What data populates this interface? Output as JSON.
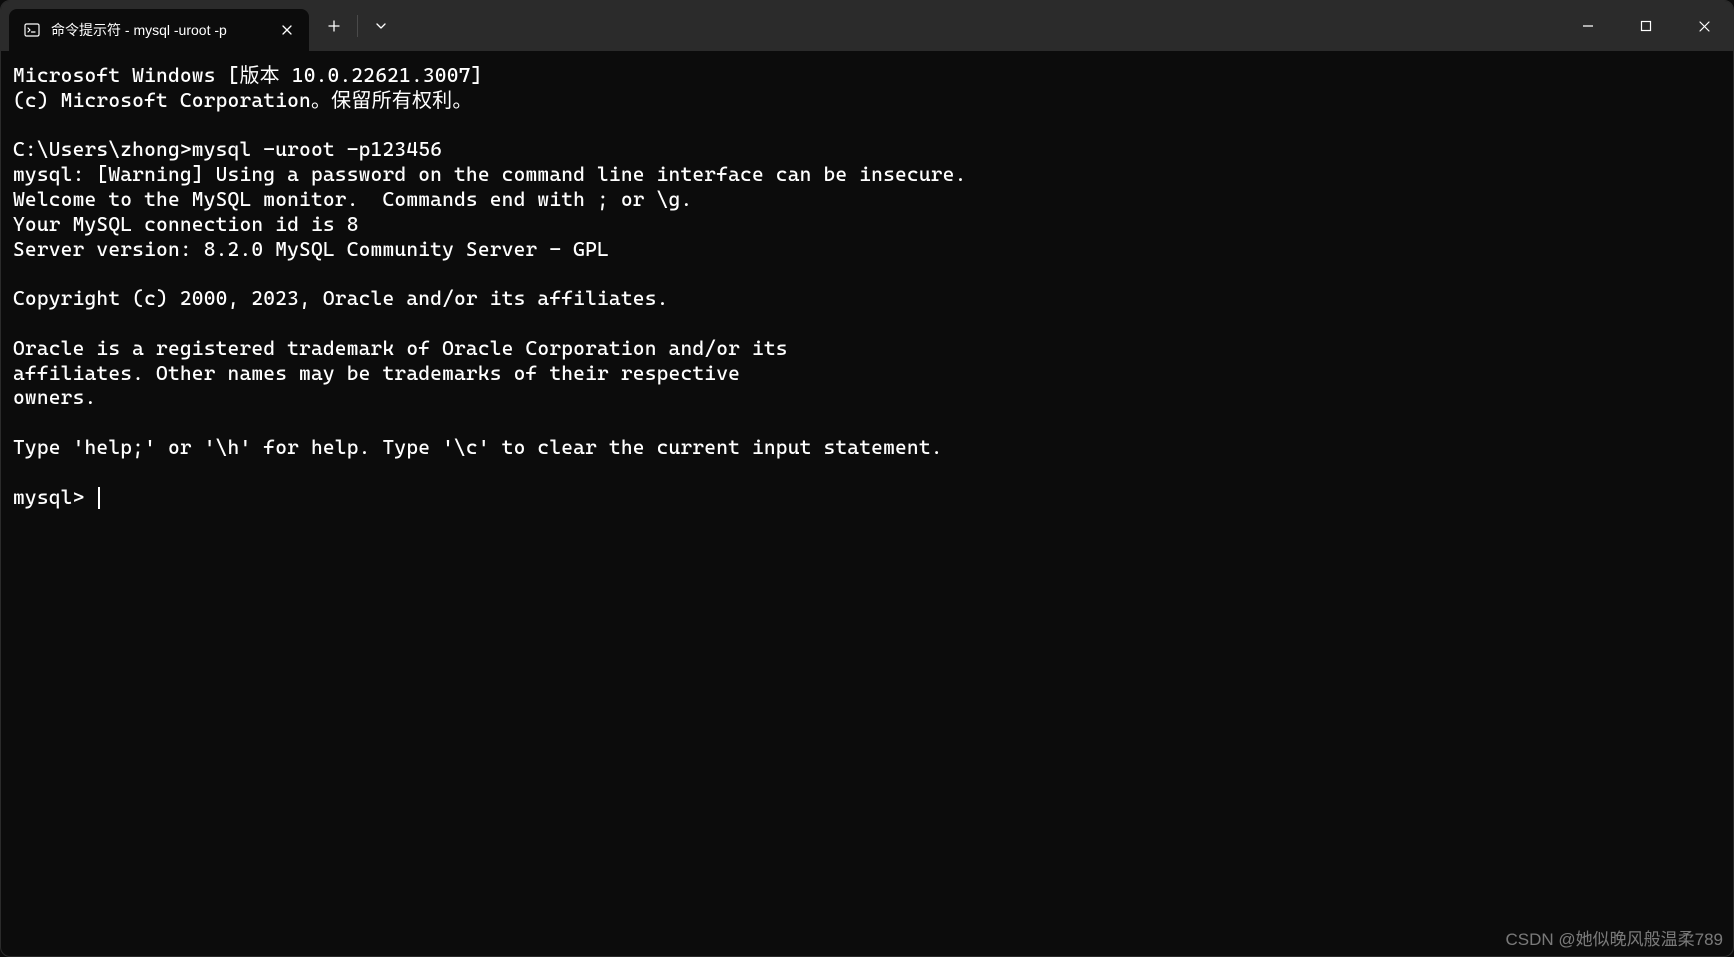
{
  "tab": {
    "title": "命令提示符 - mysql  -uroot -p"
  },
  "terminal": {
    "lines": [
      "Microsoft Windows [版本 10.0.22621.3007]",
      "(c) Microsoft Corporation。保留所有权利。",
      "",
      "C:\\Users\\zhong>mysql -uroot -p123456",
      "mysql: [Warning] Using a password on the command line interface can be insecure.",
      "Welcome to the MySQL monitor.  Commands end with ; or \\g.",
      "Your MySQL connection id is 8",
      "Server version: 8.2.0 MySQL Community Server - GPL",
      "",
      "Copyright (c) 2000, 2023, Oracle and/or its affiliates.",
      "",
      "Oracle is a registered trademark of Oracle Corporation and/or its",
      "affiliates. Other names may be trademarks of their respective",
      "owners.",
      "",
      "Type 'help;' or '\\h' for help. Type '\\c' to clear the current input statement.",
      ""
    ],
    "prompt": "mysql> "
  },
  "watermark": "CSDN @她似晚风般温柔789"
}
